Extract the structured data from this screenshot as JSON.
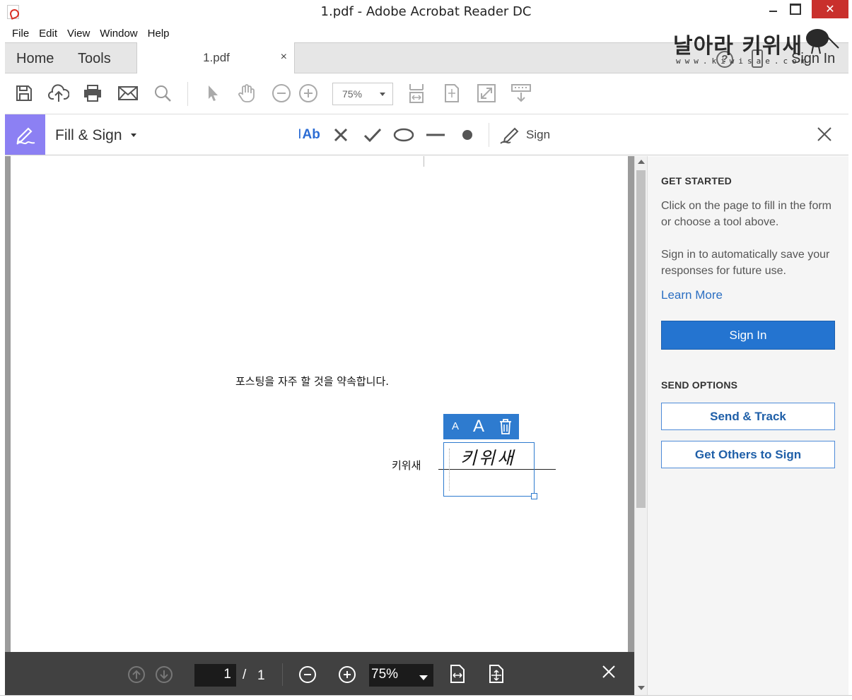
{
  "window": {
    "title": "1.pdf - Adobe Acrobat Reader DC",
    "close_glyph": "✕"
  },
  "menu": [
    "File",
    "Edit",
    "View",
    "Window",
    "Help"
  ],
  "watermark": {
    "title": "날아라 키위새",
    "url": "www.kiwisae.com"
  },
  "tabs": {
    "home": "Home",
    "tools": "Tools",
    "document": "1.pdf",
    "close_glyph": "×",
    "help_glyph": "?",
    "sign_in": "Sign In"
  },
  "toolbar": {
    "icons": [
      "save-icon",
      "cloud-upload-icon",
      "print-icon",
      "email-icon",
      "search-icon",
      "select-pointer-icon",
      "hand-tool-icon",
      "zoom-out-icon",
      "zoom-in-icon",
      "fit-width-icon",
      "fit-page-icon",
      "full-screen-icon",
      "read-mode-icon"
    ],
    "zoom_value": "75%"
  },
  "fill_sign": {
    "title": "Fill & Sign",
    "text_tool": "Ab",
    "sign_label": "Sign",
    "tools": [
      "add-text-icon",
      "cross-mark-icon",
      "check-mark-icon",
      "ellipse-icon",
      "line-icon",
      "dot-icon",
      "sign-pen-icon"
    ],
    "badge_color": "#8c80f3"
  },
  "document": {
    "pledge_text": "포스팅을 자주 할 것을 약속합니다.",
    "signer_label": "키위새",
    "signature_ink": "키위새",
    "mini_toolbar": {
      "decrease_font": "A",
      "increase_font": "A"
    }
  },
  "bottom_bar": {
    "current_page": "1",
    "separator": "/",
    "total_pages": "1",
    "zoom_value": "75%",
    "zoom_out_glyph": "−",
    "zoom_in_glyph": "+"
  },
  "right_pane": {
    "get_started_heading": "GET STARTED",
    "get_started_text": "Click on the page to fill in the form or choose a tool above.",
    "sign_in_text": "Sign in to automatically save your responses for future use.",
    "learn_more": "Learn More",
    "sign_in_button": "Sign In",
    "send_options_heading": "SEND OPTIONS",
    "send_track_button": "Send & Track",
    "get_others_button": "Get Others to Sign",
    "accent_color": "#2474d0"
  }
}
